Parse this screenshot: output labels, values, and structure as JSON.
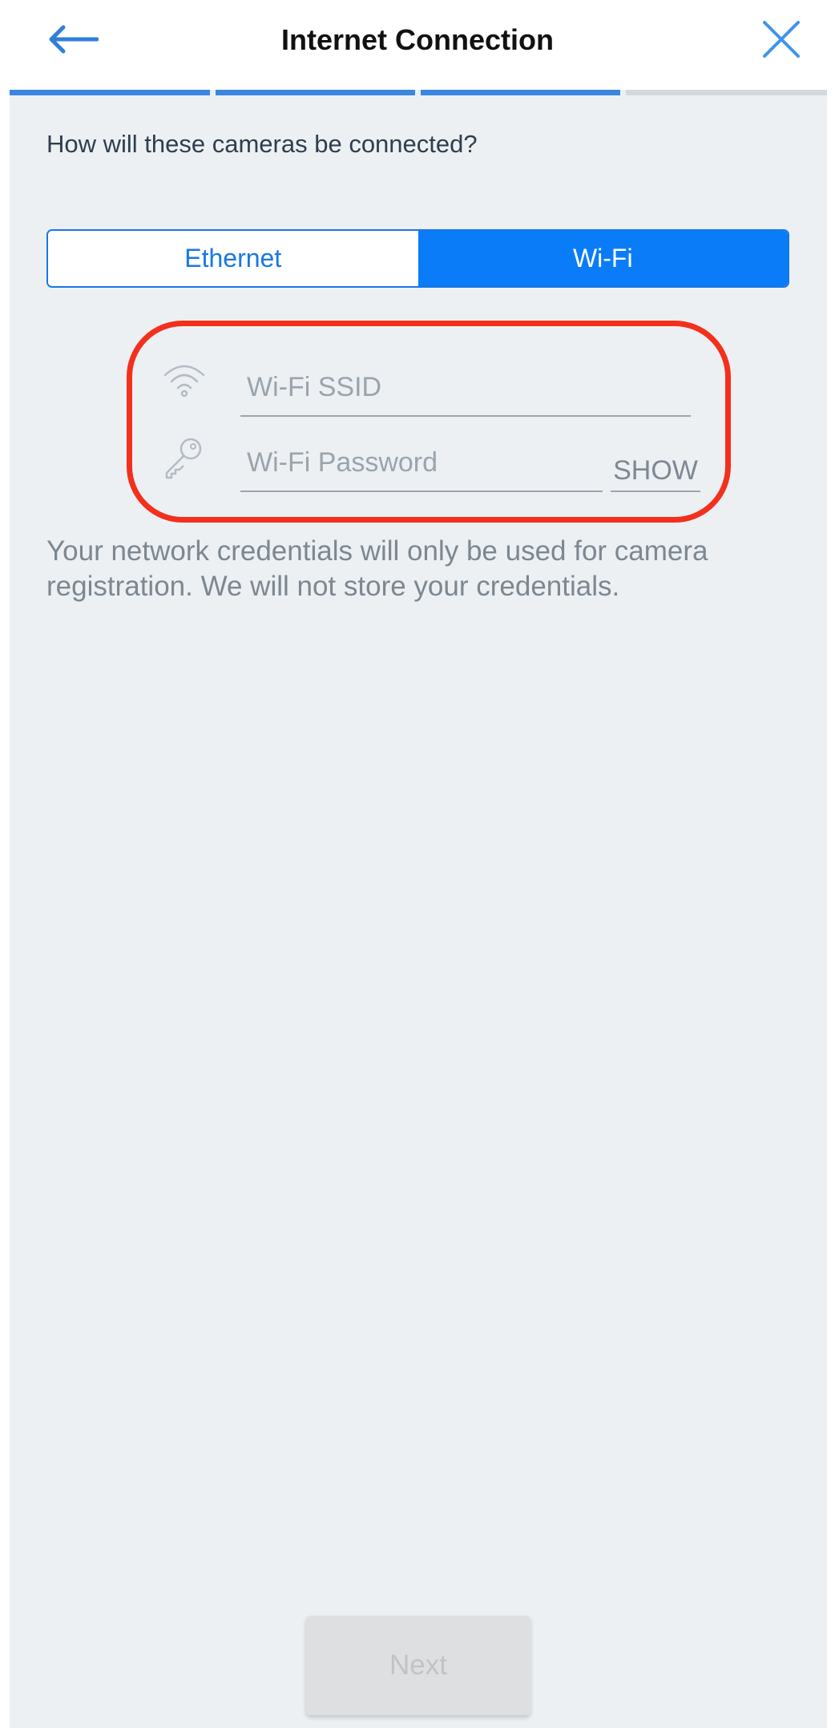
{
  "header": {
    "title": "Internet Connection",
    "back_icon": "arrow-left-icon",
    "close_icon": "close-icon"
  },
  "progress": {
    "total_steps": 4,
    "completed_steps": 3,
    "active_color": "#3a86e0",
    "inactive_color": "#d5d8dc"
  },
  "question": "How will these cameras be connected?",
  "connection_type": {
    "options": [
      "Ethernet",
      "Wi-Fi"
    ],
    "selected": "Wi-Fi",
    "accent_color": "#0a7cf8"
  },
  "form": {
    "ssid": {
      "icon": "wifi-icon",
      "placeholder": "Wi-Fi SSID",
      "value": ""
    },
    "password": {
      "icon": "key-icon",
      "placeholder": "Wi-Fi Password",
      "value": "",
      "show_label": "SHOW"
    },
    "highlight_color": "#f2301c"
  },
  "disclaimer": "Your network credentials will only be used for camera registration. We will not store your credentials.",
  "footer": {
    "next_label": "Next",
    "next_enabled": false
  }
}
